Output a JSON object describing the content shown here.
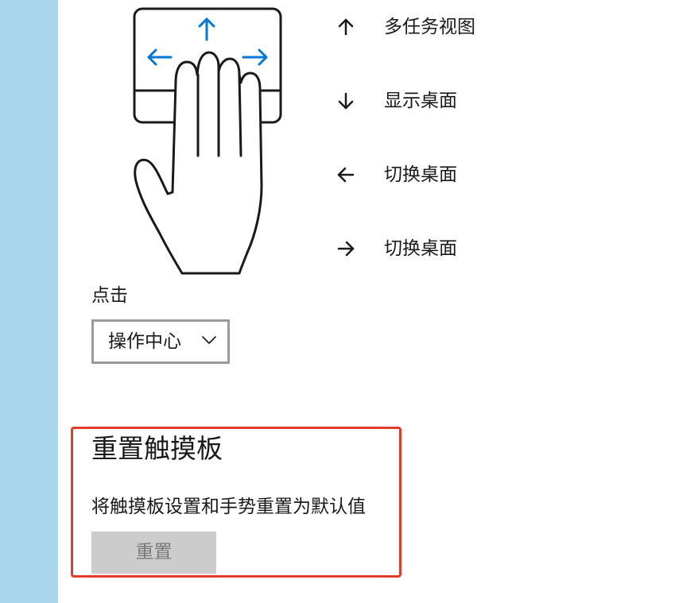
{
  "gestures": [
    {
      "arrow_icon": "arrow-up-icon",
      "label": "多任务视图"
    },
    {
      "arrow_icon": "arrow-down-icon",
      "label": "显示桌面"
    },
    {
      "arrow_icon": "arrow-left-icon",
      "label": "切换桌面"
    },
    {
      "arrow_icon": "arrow-right-icon",
      "label": "切换桌面"
    }
  ],
  "tap": {
    "label": "点击",
    "selected_value": "操作中心"
  },
  "reset": {
    "title": "重置触摸板",
    "description": "将触摸板设置和手势重置为默认值",
    "button_label": "重置",
    "button_enabled": false
  },
  "colors": {
    "sidebar": "#a9d8ec",
    "accent_arrows": "#0078d7",
    "highlight_border": "#e23b2e",
    "button_disabled_bg": "#cccccc",
    "button_disabled_text": "#7a7a7a",
    "dropdown_border": "#9a9a9a"
  }
}
